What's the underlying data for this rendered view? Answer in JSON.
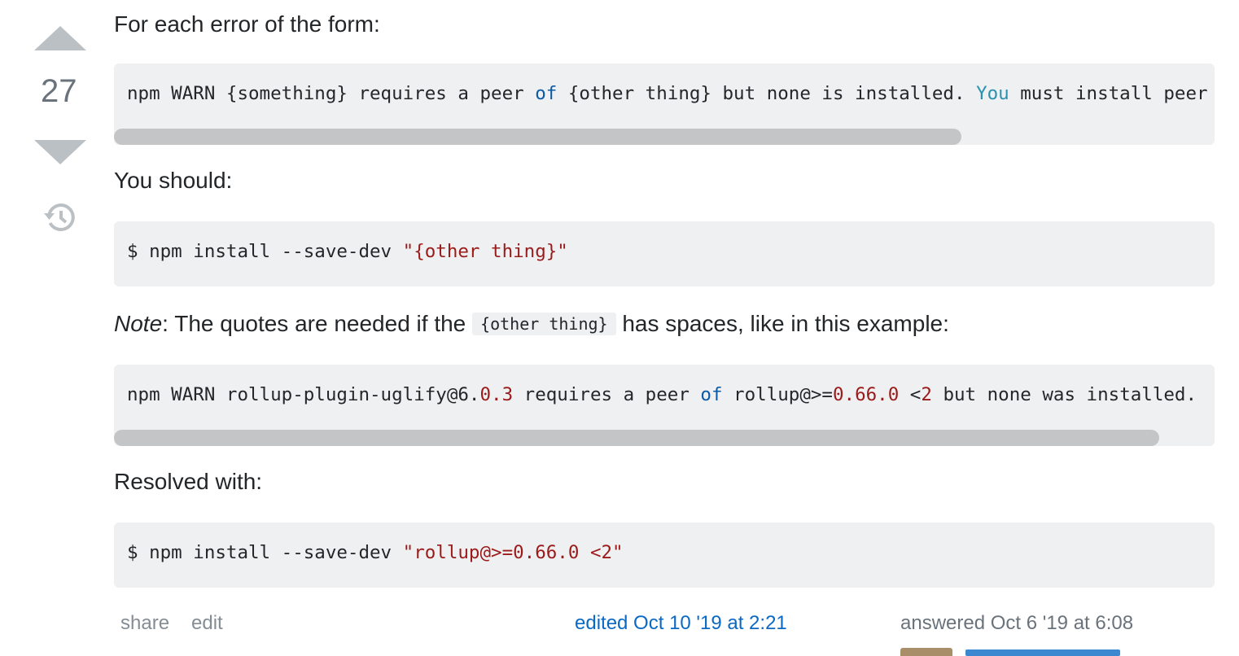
{
  "vote": {
    "count": "27"
  },
  "answer": {
    "p1": "For each error of the form:",
    "code1": {
      "parts": [
        "npm WARN {something} requires a peer ",
        "of",
        " {other thing} but none is installed. ",
        "You",
        " must install peer dependencies yourself."
      ],
      "scroll_fraction": 0.77
    },
    "p2": "You should:",
    "code2": {
      "prefix": "$ npm install --save-dev ",
      "arg": "\"{other thing}\""
    },
    "note_label": "Note",
    "note_before": ": The quotes are needed if the ",
    "note_code": "{other thing}",
    "note_after": " has spaces, like in this example:",
    "code3": {
      "parts": [
        "npm WARN rollup-plugin-uglify@6.",
        "0.3",
        " requires a peer ",
        "of",
        " rollup@>=",
        "0.66.0",
        " <",
        "2",
        " but none was installed."
      ],
      "scroll_fraction": 0.95
    },
    "p3": "Resolved with:",
    "code4": {
      "prefix": "$ npm install --save-dev ",
      "arg": "\"rollup@>=0.66.0 <2\""
    }
  },
  "footer": {
    "share_label": "share",
    "edit_label": "edit",
    "edited_text": "edited Oct 10 '19 at 2:21",
    "answered_text": "answered Oct 6 '19 at 6:08"
  }
}
